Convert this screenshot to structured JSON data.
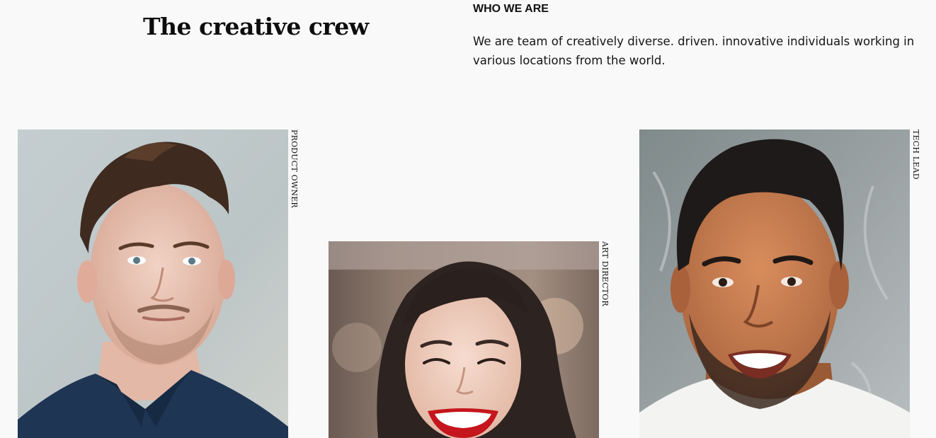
{
  "header": {
    "title": "The creative crew"
  },
  "intro": {
    "label": "WHO WE ARE",
    "text": "We are team of creatively diverse. driven. innovative individuals working in various locations from the world."
  },
  "team": [
    {
      "role": "PRODUCT OWNER",
      "photo": "man-short-hair-navy-polo-portrait"
    },
    {
      "role": "ART DIRECTOR",
      "photo": "smiling-woman-red-lipstick-portrait"
    },
    {
      "role": "TECH LEAD",
      "photo": "smiling-bearded-man-white-tee-portrait"
    }
  ],
  "colors": {
    "background": "#f9f9f9",
    "text": "#111111"
  }
}
